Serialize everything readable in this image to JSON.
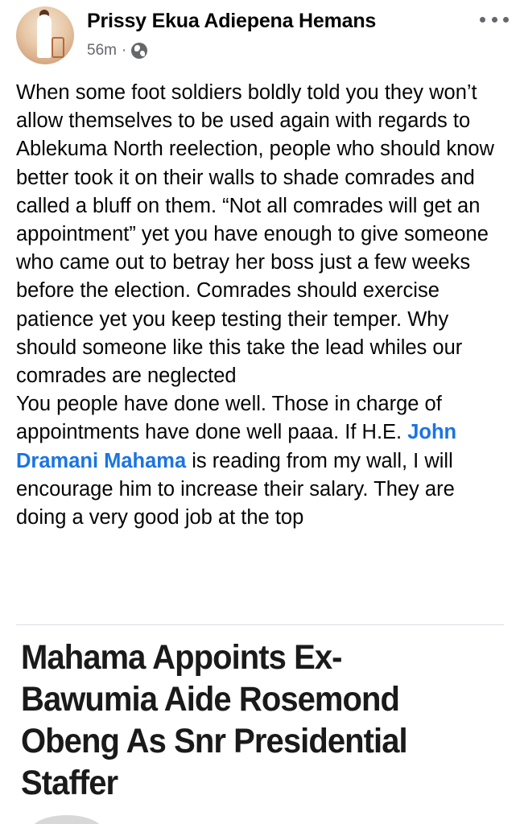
{
  "post": {
    "author": "Prissy Ekua Adiepena Hemans",
    "time": "56m",
    "separator": "·",
    "privacy_icon": "globe-icon",
    "more_icon": "more-horizontal-icon",
    "body": {
      "line1": "When some foot soldiers boldly told you they won’t allow themselves to be used again with regards to Ablekuma North reelection, people who should know better took it on their walls to shade comrades and called a bluff on them. “Not all comrades will get an appointment” yet you have enough to give someone who came out to betray her boss just a few weeks before the election. Comrades should exercise patience yet you keep testing their temper. Why should someone like this take the lead whiles our comrades are neglected",
      "line2_before": "You people have done well. Those in charge of appointments have done well paaa. If H.E. ",
      "mention": "John Dramani Mahama",
      "line2_after": " is reading from my wall, I will encourage him to increase their salary. They are doing a very good job at the top"
    }
  },
  "link_preview": {
    "headline": "Mahama Appoints Ex-Bawumia Aide Rosemond Obeng As Snr Presidential Staffer"
  },
  "colors": {
    "mention": "#1b74e4",
    "meta": "#65676b",
    "text": "#050505"
  }
}
